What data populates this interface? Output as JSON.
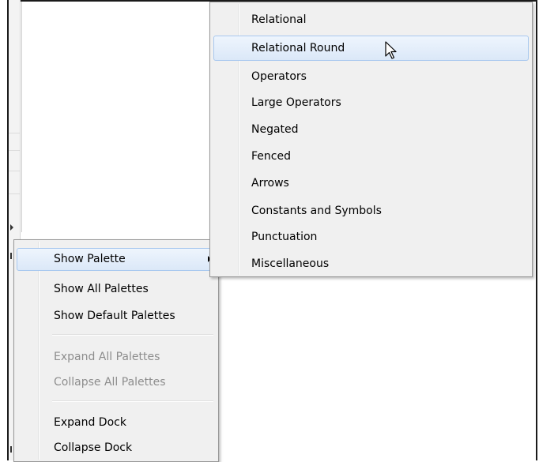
{
  "context_menu": {
    "items": [
      {
        "label": "Show Palette",
        "enabled": true,
        "highlighted": true,
        "has_submenu": true
      },
      {
        "label": "Show All Palettes",
        "enabled": true
      },
      {
        "label": "Show Default Palettes",
        "enabled": true
      },
      {
        "label": "Expand All Palettes",
        "enabled": false
      },
      {
        "label": "Collapse All Palettes",
        "enabled": false
      },
      {
        "label": "Expand Dock",
        "enabled": true
      },
      {
        "label": "Collapse Dock",
        "enabled": true
      }
    ]
  },
  "palette_submenu": {
    "items": [
      {
        "label": "Relational"
      },
      {
        "label": "Relational Round",
        "highlighted": true
      },
      {
        "label": "Operators"
      },
      {
        "label": "Large Operators"
      },
      {
        "label": "Negated"
      },
      {
        "label": "Fenced"
      },
      {
        "label": "Arrows"
      },
      {
        "label": "Constants and Symbols"
      },
      {
        "label": "Punctuation"
      },
      {
        "label": "Miscellaneous"
      }
    ]
  },
  "icons": {
    "cursor": "mouse-pointer-icon",
    "submenu_arrow": "chevron-right-icon"
  },
  "colors": {
    "highlight_border": "#a8c8ef",
    "menu_bg": "#f0f0f0",
    "disabled_text": "#8d8d8d"
  }
}
